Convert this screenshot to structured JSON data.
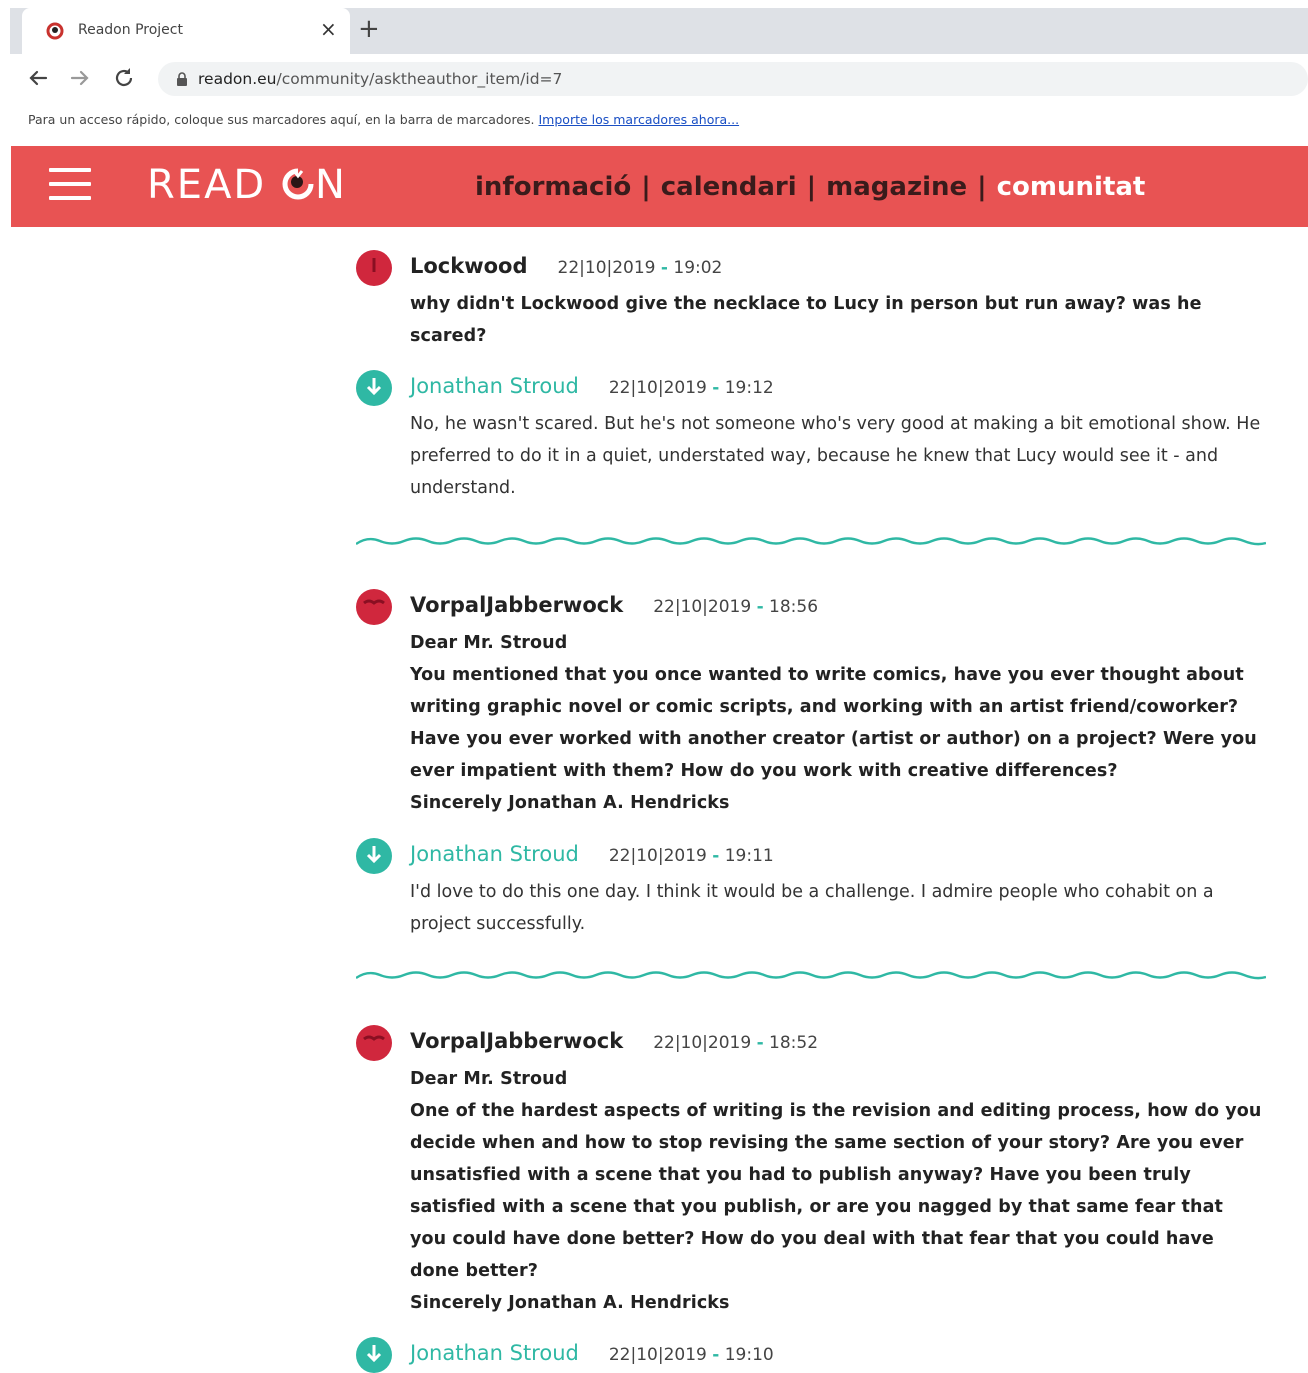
{
  "browser": {
    "tab_title": "Readon Project",
    "tab_close": "×",
    "new_tab": "+",
    "url_host": "readon.eu",
    "url_path": "/community/asktheauthor_item/id=7",
    "bookmarks_text": "Para un acceso rápido, coloque sus marcadores aquí, en la barra de marcadores.",
    "bookmarks_link": "Importe los marcadores ahora..."
  },
  "site": {
    "logo_left": "READ ",
    "logo_right": "N",
    "nav": [
      "informació",
      "calendari",
      "magazine",
      "comunitat"
    ],
    "nav_separator": "|",
    "brand_color": "#e85353",
    "accent_color": "#2fb8a4"
  },
  "posts": [
    {
      "author": "Lockwood",
      "date": "22|10|2019",
      "dash": "-",
      "time": "19:02",
      "lines": [
        "why didn't Lockwood give the necklace to Lucy in person but run away? was he scared?"
      ]
    },
    {
      "author": "Jonathan Stroud",
      "date": "22|10|2019",
      "dash": "-",
      "time": "19:12",
      "lines": [
        "No, he wasn't scared. But he's not someone who's very good at making a bit emotional show. He preferred to do it in a quiet, understated way, because he knew that Lucy would see it - and understand."
      ]
    },
    {
      "author": "VorpalJabberwock",
      "date": "22|10|2019",
      "dash": "-",
      "time": "18:56",
      "lines": [
        "Dear Mr. Stroud",
        "You mentioned that you once wanted to write comics, have you ever thought about writing graphic novel or comic scripts, and working with an artist friend/coworker? Have you ever worked with another creator (artist or author) on a project? Were you ever impatient with them? How do you work with creative differences?",
        "Sincerely Jonathan A. Hendricks"
      ]
    },
    {
      "author": "Jonathan Stroud",
      "date": "22|10|2019",
      "dash": "-",
      "time": "19:11",
      "lines": [
        "I'd love to do this one day. I think it would be a challenge. I admire people who cohabit on a project successfully."
      ]
    },
    {
      "author": "VorpalJabberwock",
      "date": "22|10|2019",
      "dash": "-",
      "time": "18:52",
      "lines": [
        "Dear Mr. Stroud",
        "One of the hardest aspects of writing is the revision and editing process, how do you decide when and how to stop revising the same section of your story? Are you ever unsatisfied with a scene that you had to publish anyway? Have you been truly satisfied with a scene that you publish, or are you nagged by that same fear that you could have done better? How do you deal with that fear that you could have done better?",
        "Sincerely Jonathan A. Hendricks"
      ]
    },
    {
      "author": "Jonathan Stroud",
      "date": "22|10|2019",
      "dash": "-",
      "time": "19:10",
      "lines": []
    }
  ]
}
